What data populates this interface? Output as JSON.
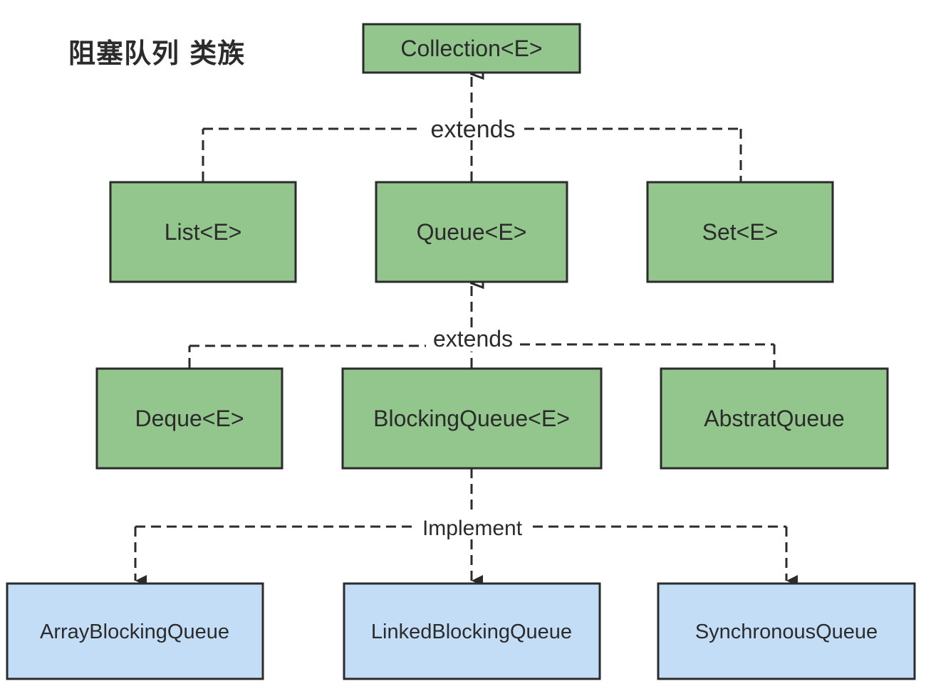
{
  "title": "阻塞队列 类族",
  "colors": {
    "interface_fill": "#93c68c",
    "class_fill": "#c3ddf7",
    "border": "#2b2b2b",
    "line": "#2b2b2b"
  },
  "nodes": {
    "collection": "Collection<E>",
    "list": "List<E>",
    "queue": "Queue<E>",
    "set": "Set<E>",
    "deque": "Deque<E>",
    "blocking_queue": "BlockingQueue<E>",
    "abstract_queue": "AbstratQueue",
    "array_blocking_queue": "ArrayBlockingQueue",
    "linked_blocking_queue": "LinkedBlockingQueue",
    "synchronous_queue": "SynchronousQueue"
  },
  "edges": {
    "extends_top": "extends",
    "extends_mid": "extends",
    "implement": "Implement"
  }
}
